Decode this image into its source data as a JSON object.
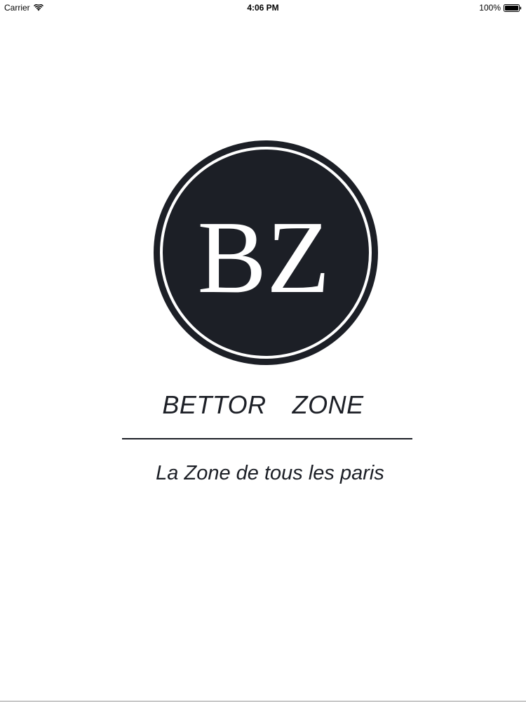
{
  "status_bar": {
    "carrier": "Carrier",
    "time": "4:06 PM",
    "battery": "100%",
    "icons": [
      "wifi-icon",
      "battery-icon"
    ]
  },
  "logo": {
    "monogram": "BZ",
    "circle_color": "#1c1f26",
    "text_color": "#ffffff"
  },
  "brand": {
    "name": "BETTOR  ZONE"
  },
  "tagline": {
    "text": "La Zone de tous les paris"
  }
}
